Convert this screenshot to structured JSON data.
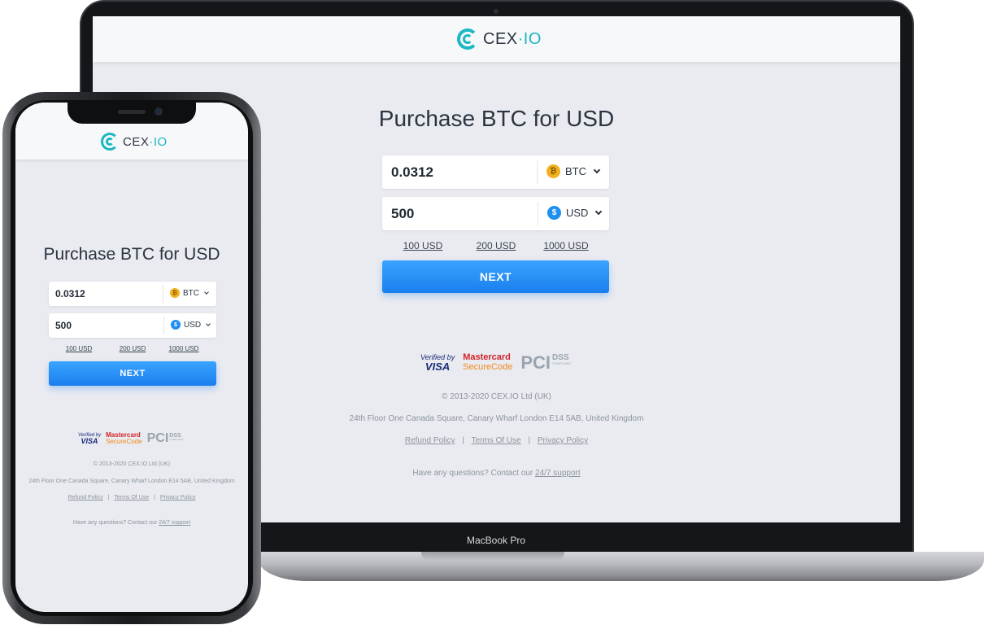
{
  "brand": {
    "name": "CEX",
    "sep": "·",
    "suffix": "IO",
    "accent": "#1bb7c2"
  },
  "laptop": {
    "model_label": "MacBook Pro"
  },
  "form": {
    "title": "Purchase BTC for USD",
    "crypto_amount": "0.0312",
    "crypto_currency": "BTC",
    "fiat_amount": "500",
    "fiat_currency": "USD",
    "quick_amounts": [
      "100 USD",
      "200 USD",
      "1000 USD"
    ],
    "next_label": "NEXT",
    "button_color": "#1f8ff0"
  },
  "badges": {
    "visa_top": "Verified by",
    "visa_bottom": "VISA",
    "mc_top": "Mastercard",
    "mc_bottom": "SecureCode",
    "pci": "PCI",
    "dss": "DSS",
    "compliant": "COMPLIANT"
  },
  "footer": {
    "copyright": "© 2013-2020 CEX.IO Ltd (UK)",
    "address": "24th Floor One Canada Square, Canary Wharf London E14 5AB, United Kingdom",
    "links": [
      "Refund Policy",
      "Terms Of Use",
      "Privacy Policy"
    ],
    "link_sep": "|",
    "contact_text": "Have any questions? Contact our ",
    "contact_link": "24/7 support"
  },
  "icons": {
    "btc": "bitcoin-coin-icon",
    "usd": "dollar-coin-icon",
    "dropdown": "chevron-down-icon"
  }
}
